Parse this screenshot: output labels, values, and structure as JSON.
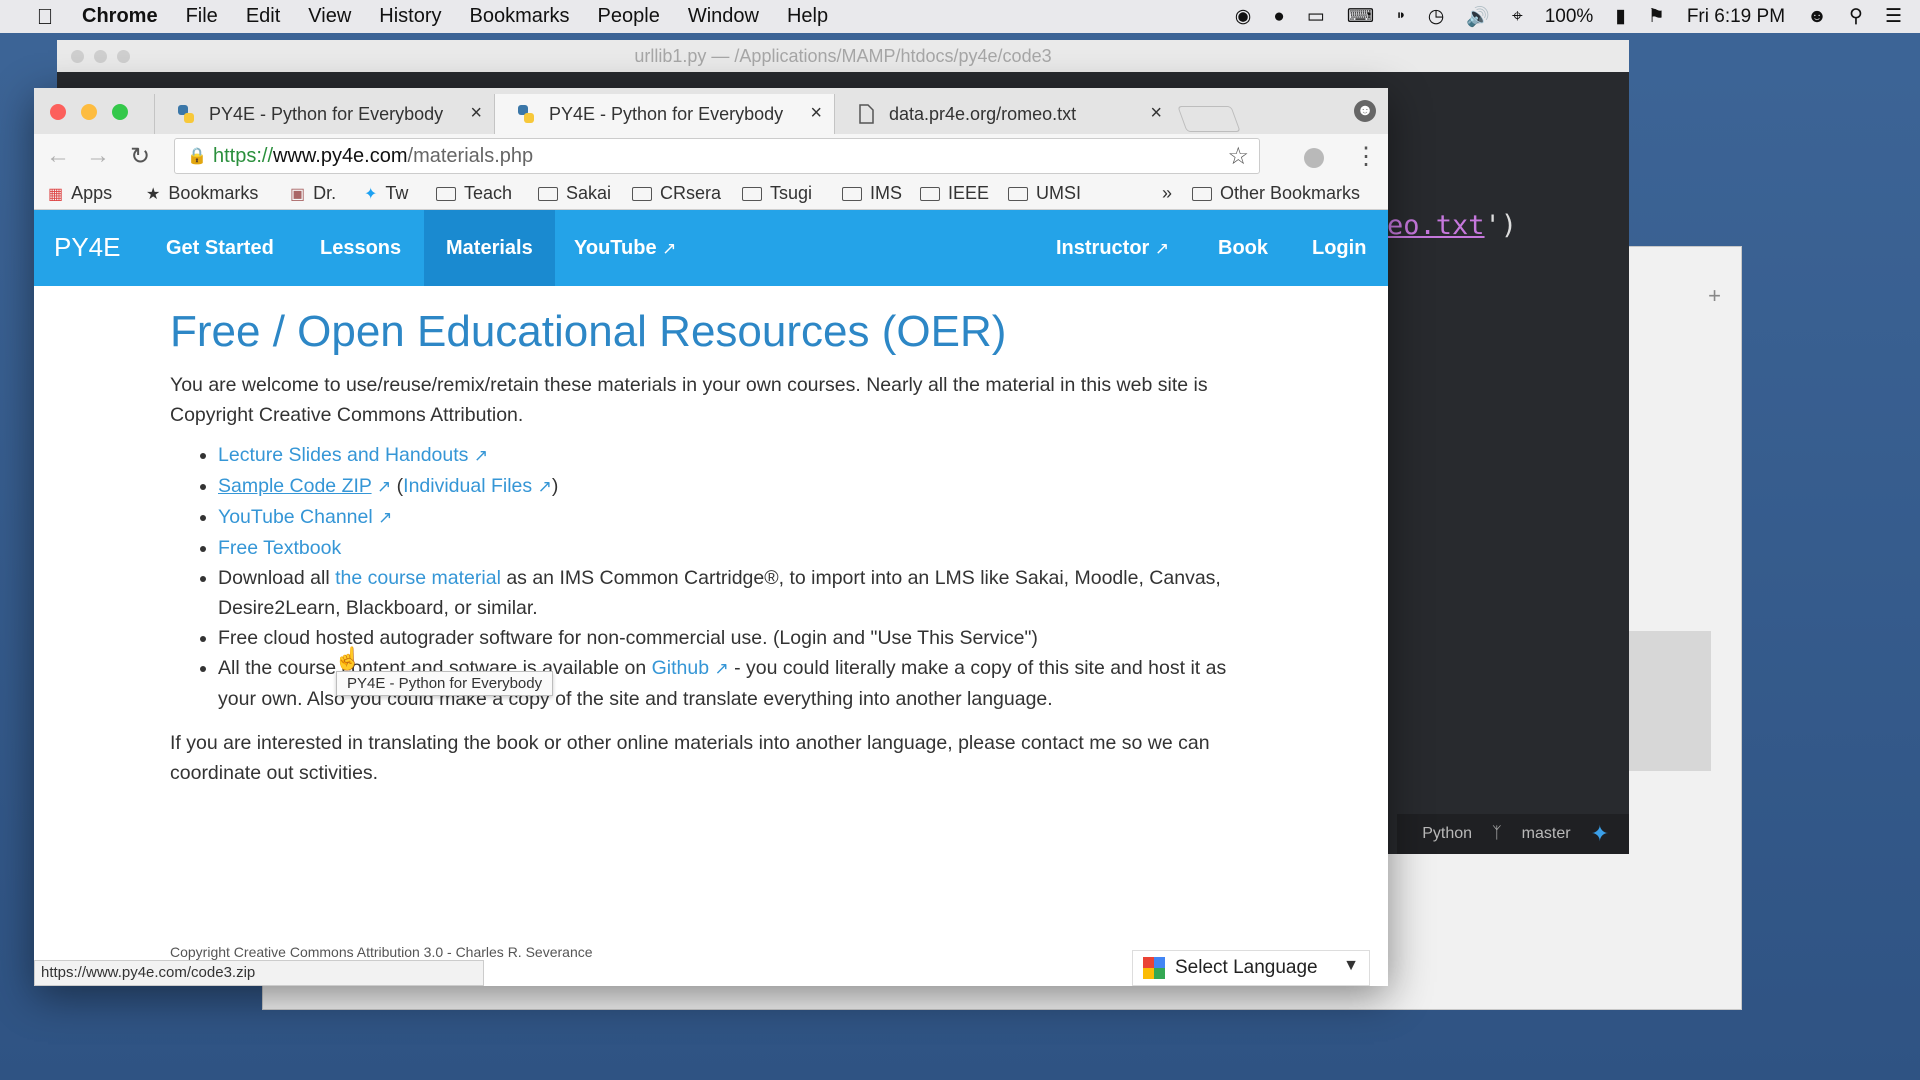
{
  "menubar": {
    "app": "Chrome",
    "items": [
      "File",
      "Edit",
      "View",
      "History",
      "Bookmarks",
      "People",
      "Window",
      "Help"
    ],
    "battery": "100%",
    "clock": "Fri 6:19 PM"
  },
  "editor": {
    "title": "urllib1.py — /Applications/MAMP/htdocs/py4e/code3",
    "code_visible": "eo.txt",
    "code_tail": "')",
    "status_lang": "Python",
    "status_branch": "master"
  },
  "tabs": [
    {
      "label": "PY4E - Python for Everybody"
    },
    {
      "label": "PY4E - Python for Everybody"
    },
    {
      "label": "data.pr4e.org/romeo.txt"
    }
  ],
  "toolbar": {
    "url_scheme": "https://",
    "url_host": "www.py4e.com",
    "url_path": "/materials.php"
  },
  "bookmarks": {
    "apps": "Apps",
    "bookmarks": "Bookmarks",
    "dr": "Dr.",
    "tw": "Tw",
    "teach": "Teach",
    "sakai": "Sakai",
    "crsera": "CRsera",
    "tsugi": "Tsugi",
    "ims": "IMS",
    "ieee": "IEEE",
    "umsi": "UMSI",
    "overflow": "»",
    "other": "Other Bookmarks"
  },
  "sitenav": {
    "brand": "PY4E",
    "get_started": "Get Started",
    "lessons": "Lessons",
    "materials": "Materials",
    "youtube": "YouTube",
    "instructor": "Instructor",
    "book": "Book",
    "login": "Login"
  },
  "content": {
    "title": "Free / Open Educational Resources (OER)",
    "intro": "You are welcome to use/reuse/remix/retain these materials in your own courses. Nearly all the material in this web site is Copyright Creative Commons Attribution.",
    "li1": "Lecture Slides and Handouts",
    "li2_a": "Sample Code ZIP",
    "li2_paren_open": " (",
    "li2_b": "Individual Files",
    "li2_paren_close": ")",
    "li3": "YouTube Channel",
    "li4": "Free Textbook",
    "li5_pre": "Download all ",
    "li5_link": "the course material",
    "li5_post": " as an IMS Common Cartridge®, to import into an LMS like Sakai, Moodle, Canvas, Desire2Learn, Blackboard, or similar.",
    "li6": "Free cloud hosted autograder software for non-commercial use. (Login and \"Use This Service\")",
    "li7_pre": "All the course content and sotware is available on ",
    "li7_link": "Github",
    "li7_post": " - you could literally make a copy of this site and host it as your own. Also you could make a copy of the site and translate everything into another language.",
    "outro": "If you are interested in translating the book or other online materials into another language, please contact me so we can coordinate out sctivities."
  },
  "tooltip": "PY4E - Python for Everybody",
  "footer": {
    "copyright": "Copyright Creative Commons Attribution 3.0 - Charles R. Severance",
    "status_url": "https://www.py4e.com/code3.zip",
    "select_language": "Select Language"
  },
  "colors": {
    "nav_blue": "#24a3e8",
    "nav_active": "#1a8ad0",
    "heading_blue": "#2d87c6",
    "link_blue": "#3596d6"
  }
}
